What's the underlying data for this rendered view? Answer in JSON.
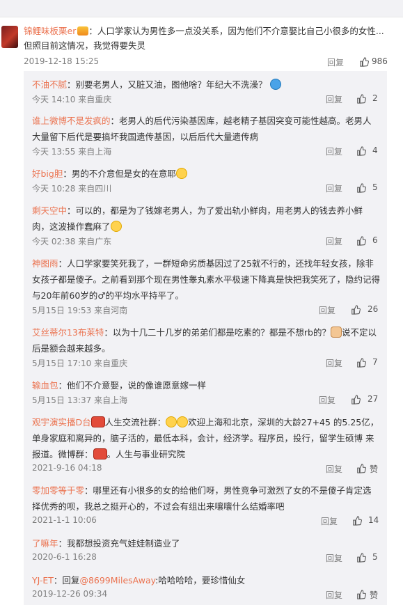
{
  "top_clip": "",
  "main": {
    "user": "锦鲤味板栗er",
    "text": "：人口学家认为男性多一点没关系，因为他们不介意娶比自己小很多的女性...但照目前这情况，我觉得要失灵",
    "time": "2019-12-18 15:25",
    "reply_label": "回复",
    "likes": "986"
  },
  "subs": [
    {
      "user": "不油不腻",
      "text": "：别要老男人，又脏又油，图他啥？年纪大不洗澡？",
      "time": "今天 14:10 来自重庆",
      "likes": "2",
      "emoji": "blue"
    },
    {
      "user": "谁上微博不是发疯的",
      "text": "：老男人的后代污染基因库，越老精子基因突变可能性越高。老男人大量留下后代是要搞坏我国遗传基因，以后后代大量遗传病",
      "time": "今天 13:55 来自上海",
      "likes": "4",
      "emoji": ""
    },
    {
      "user": "好big胆",
      "text": "：男的不介意但是女的在意耶",
      "time": "今天 10:28 来自四川",
      "likes": "5",
      "emoji": "yellow"
    },
    {
      "user": "剩天空中",
      "text": "：可以的，都是为了钱嫁老男人，为了爱出轨小鲜肉，用老男人的钱去养小鲜肉，这波操作蠢麻了",
      "time": "今天 02:38 来自广东",
      "likes": "6",
      "emoji": "yellow"
    },
    {
      "user": "神图雨",
      "text": "：人口学家要笑死我了，一群短命劣质基因过了25就不行的，还找年轻女孩，除非女孩子都是傻子。之前看到那个现在男性睾丸素水平极速下降真是快把我笑死了，隐约记得与20年前60岁的♂的平均水平持平了。",
      "time": "5月15日 19:53 来自河南",
      "likes": "26",
      "emoji": ""
    },
    {
      "user": "艾丝蒂尔13布莱特",
      "text": "：以为十几二十几岁的弟弟们都是吃素的？都是不想rb的？",
      "text2": "说不定以后是额会越来越多。",
      "time": "5月15日 17:10 来自重庆",
      "likes": "7",
      "emoji": "cat"
    },
    {
      "user": "输血包",
      "text": "：他们不介意娶，说的像谁愿意嫁一样",
      "time": "5月15日 13:37 来自上海",
      "likes": "27",
      "emoji": ""
    },
    {
      "user": "观宇演实播D台",
      "text": "人生交流社群：",
      "text2": "欢迎上海和北京，深圳的大龄27+45 的5.25亿，单身家庭和离异的，脑子活的，最低本科，会计，经济学。程序员，投行，留学生硕博 来报道。微博群：",
      "text3": "。人生与事业研究院",
      "time": "2021-9-16 04:18",
      "likes": "赞",
      "emoji": "red"
    },
    {
      "user": "零加零等于零",
      "text": "：哪里还有小很多的女的给他们呀，男性竞争可激烈了女的不是傻子肯定选择优秀的呗，我总之挺开心的，不过会有组出来嚷嚷什么结婚率吧",
      "time": "2021-1-1 10:06",
      "likes": "14",
      "emoji": ""
    },
    {
      "user": "了嘛年",
      "text": "：我都想投资充气娃娃制造业了",
      "time": "2020-6-1 16:28",
      "likes": "5",
      "emoji": ""
    },
    {
      "user": "YJ-ET",
      "text": "：回复",
      "mention": "@8699MilesAway",
      "text2": ":哈哈哈哈，要珍惜仙女",
      "time": "2019-12-26 09:34",
      "likes": "赞",
      "emoji": ""
    }
  ]
}
